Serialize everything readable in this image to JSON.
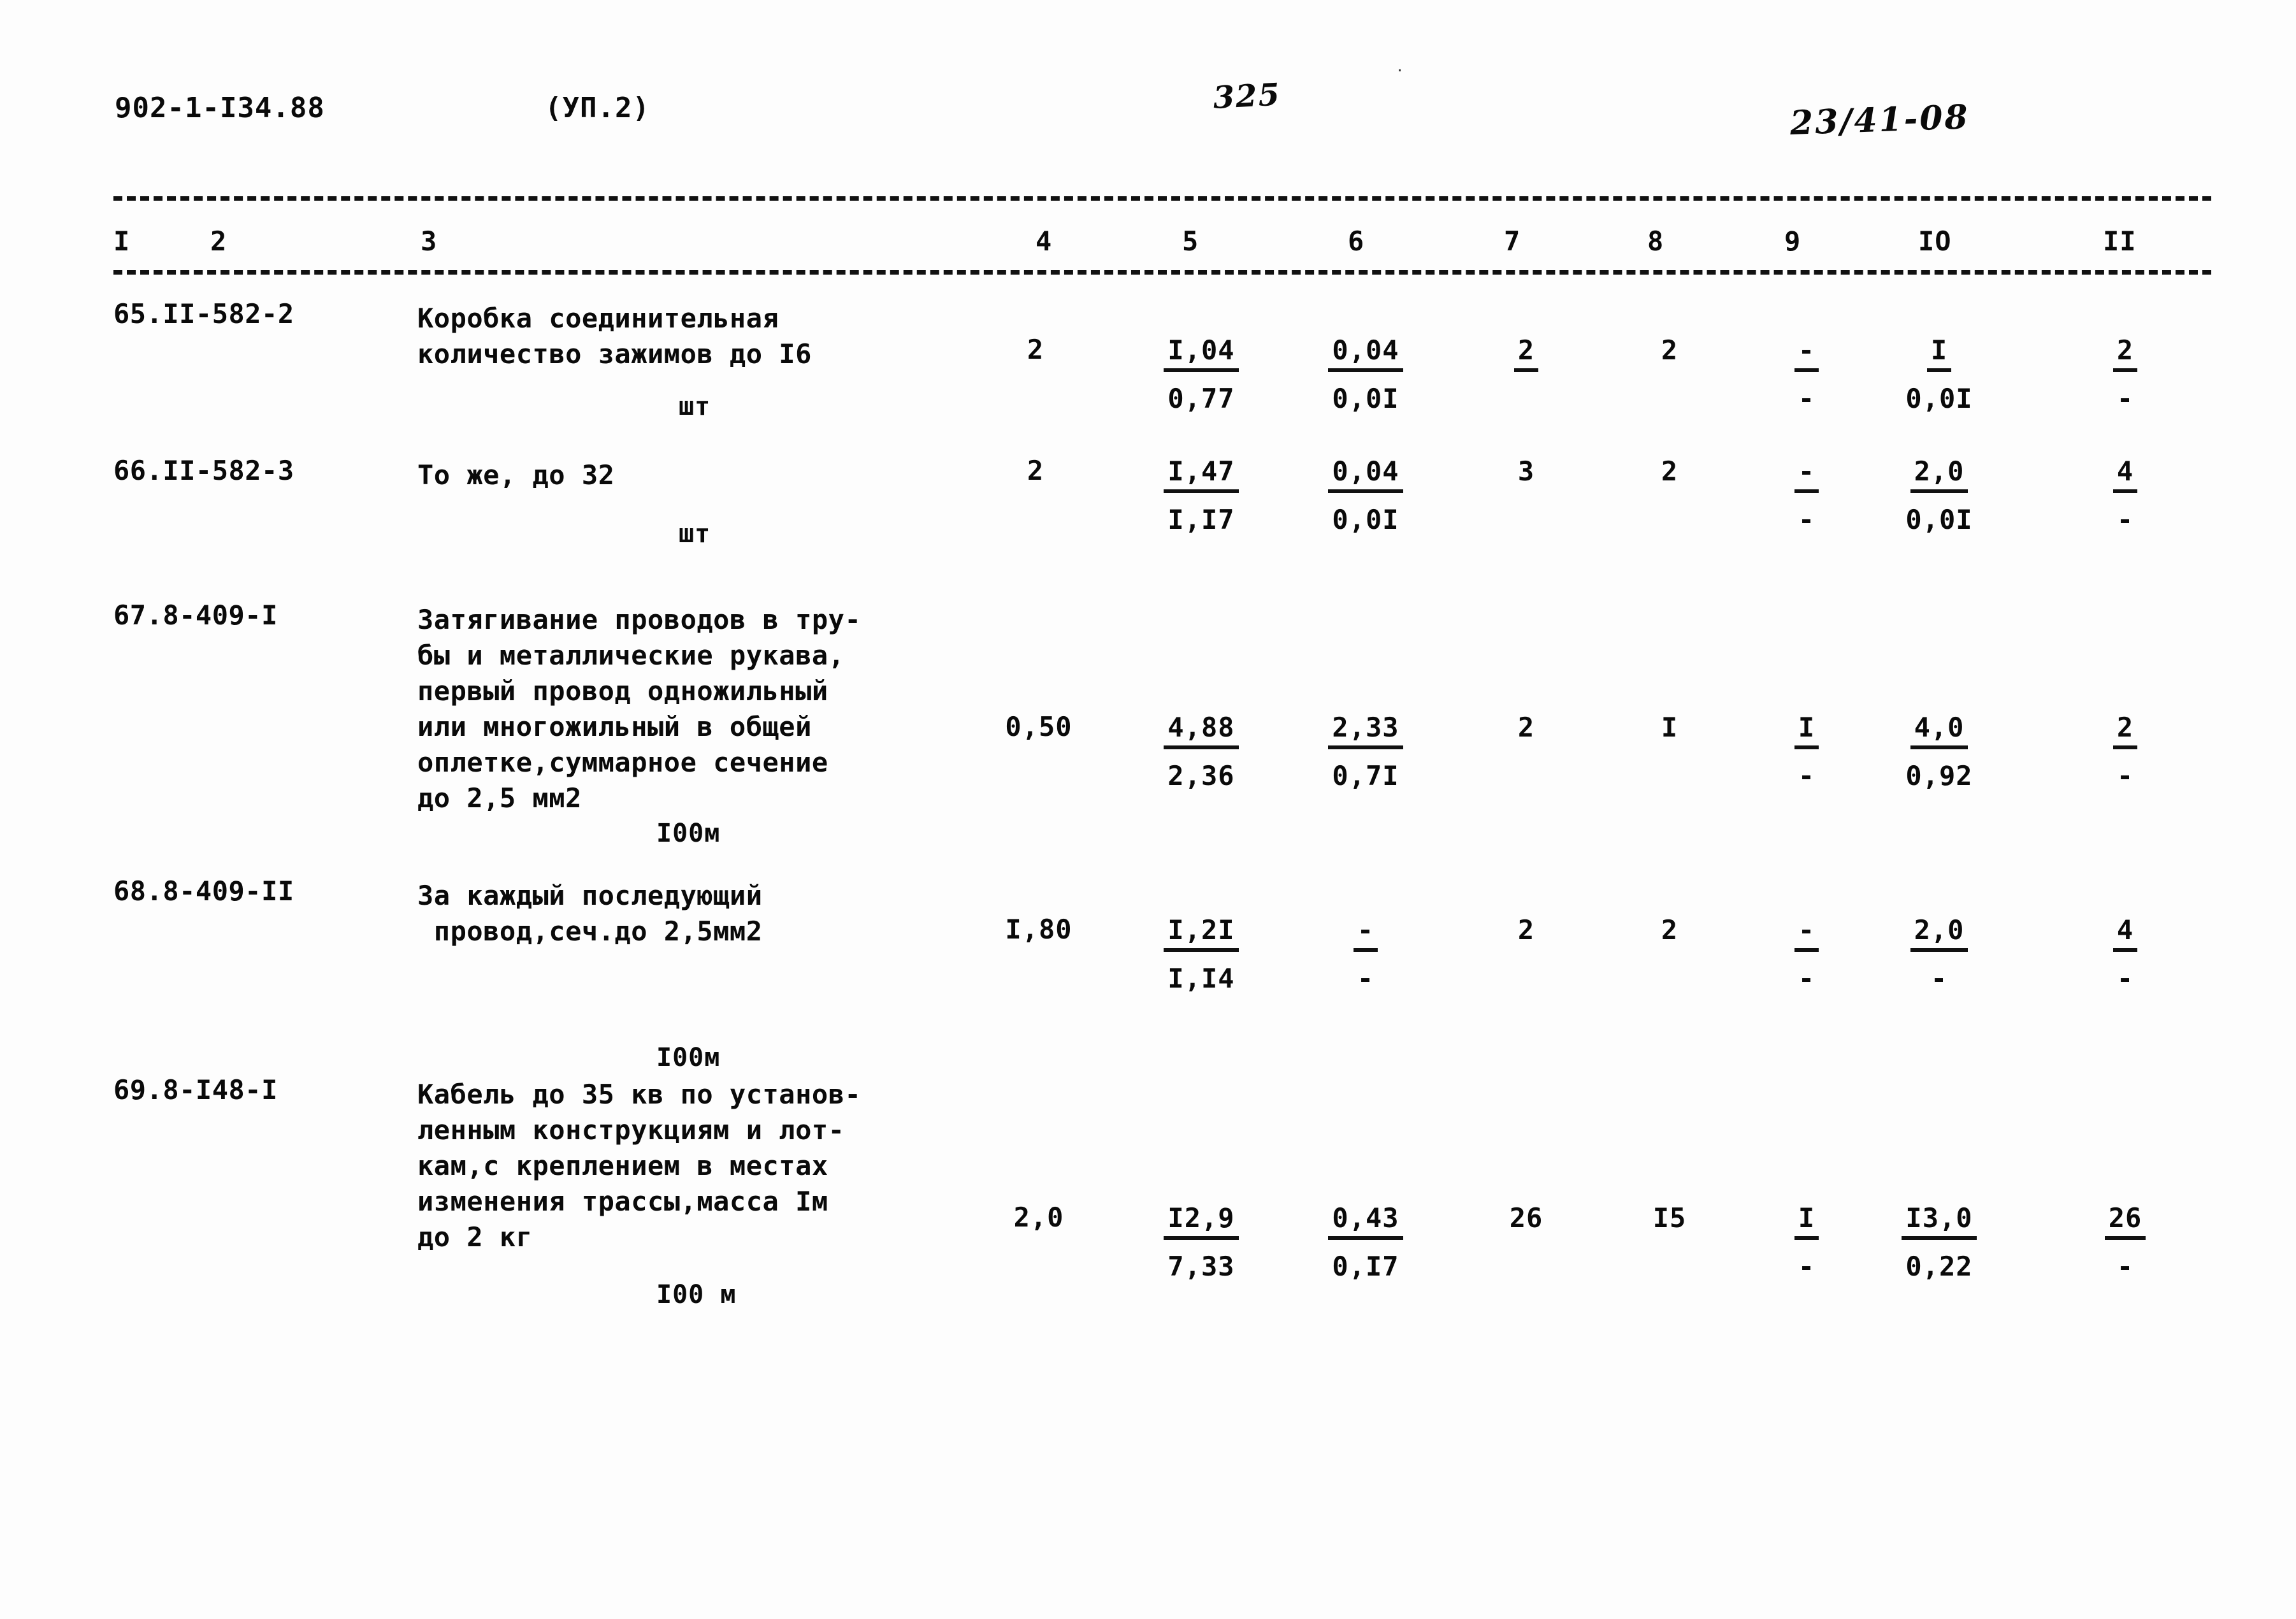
{
  "header": {
    "doc_code": "902-1-I34.88",
    "variant": "(УП.2)",
    "page_number": "325",
    "stamp": "23/41-08",
    "ink_mark": "."
  },
  "table": {
    "column_headers": [
      "I",
      "2",
      "3",
      "4",
      "5",
      "6",
      "7",
      "8",
      "9",
      "IO",
      "II"
    ],
    "rows": [
      {
        "code": "65.II-582-2",
        "desc_lines": [
          "Коробка соединительная",
          "количество зажимов до I6"
        ],
        "unit": "шт",
        "c4": "2",
        "c5_top": "I,04",
        "c5_bot": "0,77",
        "c6_top": "0,04",
        "c6_bot": "0,0I",
        "c7": "2",
        "c8": "2",
        "c9_top": "-",
        "c9_bot": "-",
        "c10_top": "I",
        "c10_bot": "0,0I",
        "c11_top": "2",
        "c11_bot": "-"
      },
      {
        "code": "66.II-582-3",
        "desc_lines": [
          "То же, до 32"
        ],
        "unit": "шт",
        "c4": "2",
        "c5_top": "I,47",
        "c5_bot": "I,I7",
        "c6_top": "0,04",
        "c6_bot": "0,0I",
        "c7": "3",
        "c8": "2",
        "c9_top": "-",
        "c9_bot": "-",
        "c10_top": "2,0",
        "c10_bot": "0,0I",
        "c11_top": "4",
        "c11_bot": "-"
      },
      {
        "code": "67.8-409-I",
        "desc_lines": [
          "Затягивание проводов в тру-",
          "бы и металлические рукава,",
          "первый провод одножильный",
          "или многожильный в общей",
          "оплетке,суммарное сечение",
          "до 2,5 мм2"
        ],
        "unit": "I00м",
        "c4": "0,50",
        "c5_top": "4,88",
        "c5_bot": "2,36",
        "c6_top": "2,33",
        "c6_bot": "0,7I",
        "c7": "2",
        "c8": "I",
        "c9_top": "I",
        "c9_bot": "-",
        "c10_top": "4,0",
        "c10_bot": "0,92",
        "c11_top": "2",
        "c11_bot": "-"
      },
      {
        "code": "68.8-409-II",
        "desc_lines": [
          "За каждый последующий",
          " провод,сеч.до 2,5мм2"
        ],
        "unit": "I00м",
        "c4": "I,80",
        "c5_top": "I,2I",
        "c5_bot": "I,I4",
        "c6_top": "-",
        "c6_bot": "-",
        "c7": "2",
        "c8": "2",
        "c9_top": "-",
        "c9_bot": "-",
        "c10_top": "2,0",
        "c10_bot": "-",
        "c11_top": "4",
        "c11_bot": "-"
      },
      {
        "code": "69.8-I48-I",
        "desc_lines": [
          "Кабель до 35 кв по установ-",
          "ленным конструкциям и лот-",
          "кам,с креплением в местах",
          "изменения трассы,масса Iм",
          "до 2 кг"
        ],
        "unit": "I00 м",
        "c4": "2,0",
        "c5_top": "I2,9",
        "c5_bot": "7,33",
        "c6_top": "0,43",
        "c6_bot": "0,I7",
        "c7": "26",
        "c8": "I5",
        "c9_top": "I",
        "c9_bot": "-",
        "c10_top": "I3,0",
        "c10_bot": "0,22",
        "c11_top": "26",
        "c11_bot": "-"
      }
    ]
  }
}
